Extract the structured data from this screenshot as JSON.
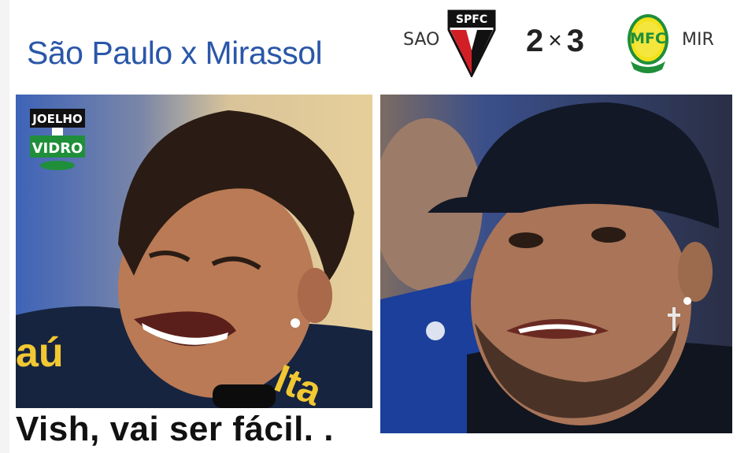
{
  "header": {
    "title": "São Paulo x Mirassol",
    "home_abbr": "SAO",
    "away_abbr": "MIR",
    "home_score": "2",
    "separator": "×",
    "away_score": "3",
    "home_crest_text": "SPFC",
    "away_crest_text": "MFC"
  },
  "left_panel": {
    "watermark": "Joelho de Vidro",
    "jersey_text": "Itaú"
  },
  "caption": "Vish, vai ser fácil. .",
  "colors": {
    "title_blue": "#2a57a8",
    "spfc_red": "#d21f26",
    "mirassol_yellow": "#f3e21b",
    "mirassol_green": "#1f8f3a"
  }
}
